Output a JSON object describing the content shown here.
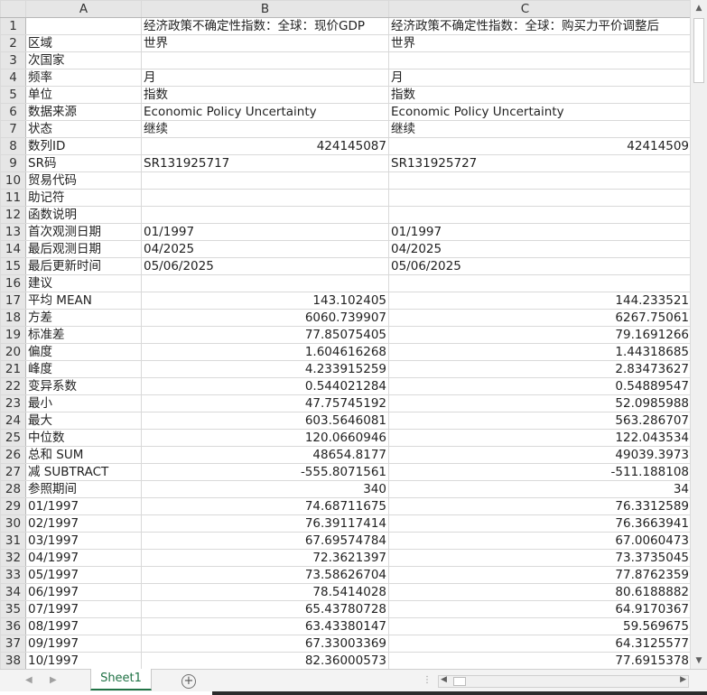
{
  "columns": [
    "A",
    "B",
    "C"
  ],
  "rows": [
    {
      "n": "1",
      "a": "",
      "b": "经济政策不确定性指数：全球：现价GDP",
      "c": "经济政策不确定性指数：全球：购买力平价调整后"
    },
    {
      "n": "2",
      "a": "区域",
      "b": "世界",
      "c": "世界"
    },
    {
      "n": "3",
      "a": "次国家",
      "b": "",
      "c": ""
    },
    {
      "n": "4",
      "a": "频率",
      "b": "月",
      "c": "月"
    },
    {
      "n": "5",
      "a": "单位",
      "b": "指数",
      "c": "指数"
    },
    {
      "n": "6",
      "a": "数据来源",
      "b": "Economic Policy Uncertainty",
      "c": "Economic Policy Uncertainty"
    },
    {
      "n": "7",
      "a": "状态",
      "b": "继续",
      "c": "继续"
    },
    {
      "n": "8",
      "a": "数列ID",
      "b": "424145087",
      "c": "42414509",
      "num": true
    },
    {
      "n": "9",
      "a": "SR码",
      "b": "SR131925717",
      "c": "SR131925727"
    },
    {
      "n": "10",
      "a": "贸易代码",
      "b": "",
      "c": ""
    },
    {
      "n": "11",
      "a": "助记符",
      "b": "",
      "c": ""
    },
    {
      "n": "12",
      "a": "函数说明",
      "b": "",
      "c": ""
    },
    {
      "n": "13",
      "a": "首次观测日期",
      "b": "01/1997",
      "c": "01/1997"
    },
    {
      "n": "14",
      "a": "最后观测日期",
      "b": "04/2025",
      "c": "04/2025"
    },
    {
      "n": "15",
      "a": "最后更新时间",
      "b": "05/06/2025",
      "c": "05/06/2025"
    },
    {
      "n": "16",
      "a": "建议",
      "b": "",
      "c": ""
    },
    {
      "n": "17",
      "a": "平均 MEAN",
      "b": "143.102405",
      "c": "144.233521",
      "num": true
    },
    {
      "n": "18",
      "a": "方差",
      "b": "6060.739907",
      "c": "6267.75061",
      "num": true
    },
    {
      "n": "19",
      "a": "标准差",
      "b": "77.85075405",
      "c": "79.1691266",
      "num": true
    },
    {
      "n": "20",
      "a": "偏度",
      "b": "1.604616268",
      "c": "1.44318685",
      "num": true
    },
    {
      "n": "21",
      "a": "峰度",
      "b": "4.233915259",
      "c": "2.83473627",
      "num": true
    },
    {
      "n": "22",
      "a": "变异系数",
      "b": "0.544021284",
      "c": "0.54889547",
      "num": true
    },
    {
      "n": "23",
      "a": "最小",
      "b": "47.75745192",
      "c": "52.0985988",
      "num": true
    },
    {
      "n": "24",
      "a": "最大",
      "b": "603.5646081",
      "c": "563.286707",
      "num": true
    },
    {
      "n": "25",
      "a": "中位数",
      "b": "120.0660946",
      "c": "122.043534",
      "num": true
    },
    {
      "n": "26",
      "a": "总和 SUM",
      "b": "48654.8177",
      "c": "49039.3973",
      "num": true
    },
    {
      "n": "27",
      "a": "减 SUBTRACT",
      "b": "-555.8071561",
      "c": "-511.188108",
      "num": true
    },
    {
      "n": "28",
      "a": "参照期间",
      "b": "340",
      "c": "34",
      "num": true
    },
    {
      "n": "29",
      "a": "01/1997",
      "b": "74.68711675",
      "c": "76.3312589",
      "num": true
    },
    {
      "n": "30",
      "a": "02/1997",
      "b": "76.39117414",
      "c": "76.3663941",
      "num": true
    },
    {
      "n": "31",
      "a": "03/1997",
      "b": "67.69574784",
      "c": "67.0060473",
      "num": true
    },
    {
      "n": "32",
      "a": "04/1997",
      "b": "72.3621397",
      "c": "73.3735045",
      "num": true
    },
    {
      "n": "33",
      "a": "05/1997",
      "b": "73.58626704",
      "c": "77.8762359",
      "num": true
    },
    {
      "n": "34",
      "a": "06/1997",
      "b": "78.5414028",
      "c": "80.6188882",
      "num": true
    },
    {
      "n": "35",
      "a": "07/1997",
      "b": "65.43780728",
      "c": "64.9170367",
      "num": true
    },
    {
      "n": "36",
      "a": "08/1997",
      "b": "63.43380147",
      "c": "59.569675",
      "num": true
    },
    {
      "n": "37",
      "a": "09/1997",
      "b": "67.33003369",
      "c": "64.3125577",
      "num": true
    },
    {
      "n": "38",
      "a": "10/1997",
      "b": "82.36000573",
      "c": "77.6915378",
      "num": true
    }
  ],
  "sheet_tab": "Sheet1",
  "add_sheet_symbol": "+",
  "icons": {
    "scroll_up": "▲",
    "scroll_down": "▼",
    "nav_prev": "◀",
    "nav_next": "▶",
    "scroll_left": "◀",
    "scroll_right": "▶",
    "split": "⋮"
  },
  "colors": {
    "tab_accent": "#217346",
    "header_bg": "#e6e6e6"
  }
}
